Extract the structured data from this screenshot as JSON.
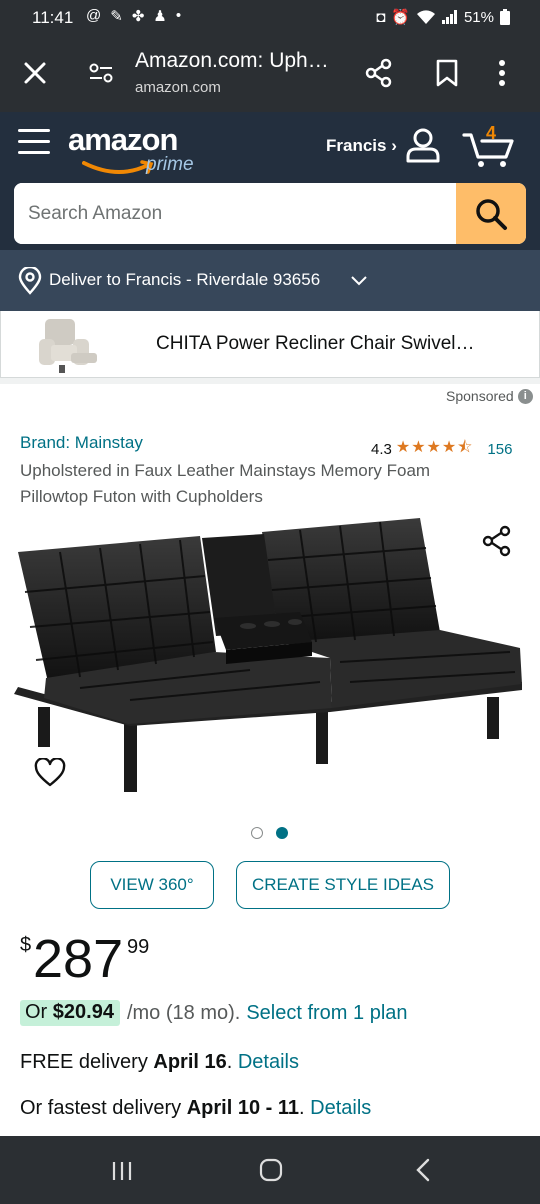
{
  "status_bar": {
    "time": "11:41",
    "battery": "51%"
  },
  "browser": {
    "title": "Amazon.com: Uph…",
    "url": "amazon.com"
  },
  "header": {
    "logo_text": "amazon",
    "logo_sub": "prime",
    "account_label": "Francis ›",
    "cart_count": "4"
  },
  "search": {
    "placeholder": "Search Amazon"
  },
  "deliver": {
    "text": "Deliver to Francis - Riverdale 93656"
  },
  "sponsored_product": {
    "name": "CHITA Power Recliner Chair Swivel…"
  },
  "sponsored_label": "Sponsored",
  "product": {
    "brand": "Brand: Mainstay",
    "rating": "4.3",
    "stars": "★★★★⯪",
    "rating_count": "156",
    "title": "Upholstered in Faux Leather Mainstays Memory Foam Pillowtop Futon with Cupholders"
  },
  "buttons": {
    "view360": "VIEW 360°",
    "style_ideas": "CREATE STYLE IDEAS"
  },
  "price": {
    "symbol": "$",
    "whole": "287",
    "fraction": "99"
  },
  "monthly": {
    "prefix": "Or ",
    "amount": "$20.94",
    "term": "/mo (18 mo).",
    "plan_link": "Select from 1 plan"
  },
  "delivery": {
    "free_prefix": "FREE delivery ",
    "free_date": "April 16",
    "free_suffix": ". ",
    "free_link": "Details",
    "fast_prefix": "Or fastest delivery ",
    "fast_date": "April 10 - 11",
    "fast_suffix": ". ",
    "fast_link": "Details"
  },
  "colors": {
    "header_bg": "#232f3e",
    "deliver_bg": "#37475a",
    "search_button": "#febd69",
    "link": "#007185",
    "cart_count": "#f08804",
    "star": "#de7921",
    "emi_bg": "#c5f0d9"
  }
}
